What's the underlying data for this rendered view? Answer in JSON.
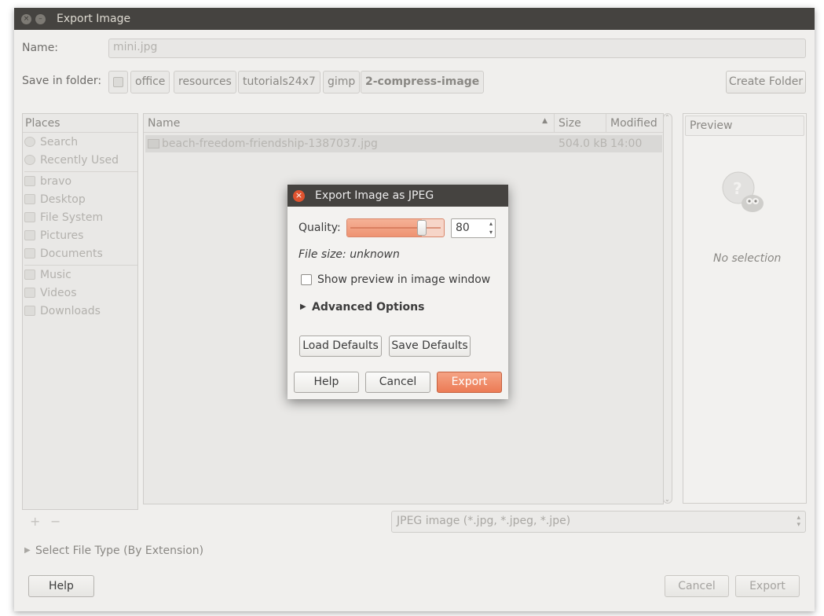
{
  "window": {
    "title": "Export Image"
  },
  "name_row": {
    "label": "Name:",
    "value": "mini.jpg"
  },
  "folder_row": {
    "label": "Save in folder:",
    "crumbs": [
      "office",
      "resources",
      "tutorials24x7",
      "gimp",
      "2-compress-image"
    ],
    "create_folder": "Create Folder"
  },
  "places": {
    "header": "Places",
    "items": [
      "Search",
      "Recently Used",
      "bravo",
      "Desktop",
      "File System",
      "Pictures",
      "Documents",
      "Music",
      "Videos",
      "Downloads"
    ]
  },
  "filelist": {
    "columns": {
      "name": "Name",
      "size": "Size",
      "modified": "Modified"
    },
    "rows": [
      {
        "name": "beach-freedom-friendship-1387037.jpg",
        "size": "504.0 kB",
        "modified": "14:00"
      }
    ]
  },
  "preview": {
    "header": "Preview",
    "empty": "No selection"
  },
  "filter": {
    "add": "+",
    "remove": "−",
    "type": "JPEG image (*.jpg, *.jpeg, *.jpe)"
  },
  "select_type": "Select File Type (By Extension)",
  "buttons": {
    "help": "Help",
    "cancel": "Cancel",
    "export": "Export"
  },
  "dialog": {
    "title": "Export Image as JPEG",
    "quality_label": "Quality:",
    "quality_value": "80",
    "quality_fraction": 0.8,
    "file_size": "File size: unknown",
    "show_preview": "Show preview in image window",
    "show_preview_checked": false,
    "advanced": "Advanced Options",
    "load_defaults": "Load Defaults",
    "save_defaults": "Save Defaults",
    "help": "Help",
    "cancel": "Cancel",
    "export": "Export"
  },
  "colors": {
    "accent": "#e8663c",
    "titlebar": "#454340",
    "close": "#e0532f"
  }
}
